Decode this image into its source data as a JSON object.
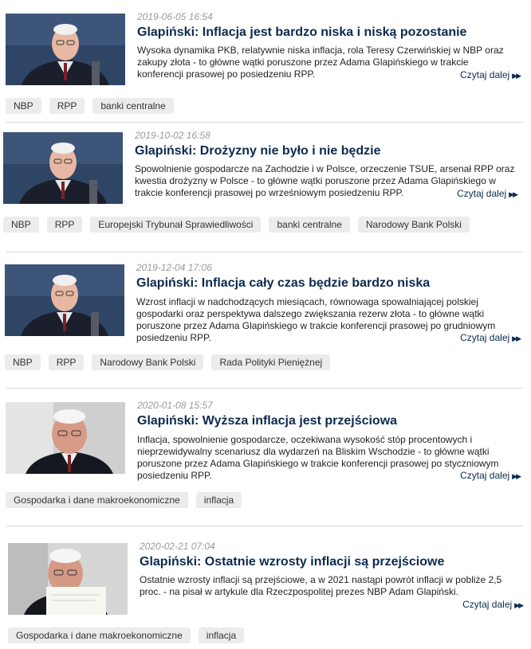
{
  "articles": [
    {
      "date": "2019-06-05 16:54",
      "title": "Glapiński: Inflacja jest bardzo niska i niską pozostanie",
      "desc": "Wysoka dynamika PKB, relatywnie niska inflacja, rola Teresy Czerwińskiej w NBP oraz zakupy złota - to główne wątki poruszone przez Adama Glapińskiego w trakcie konferencji prasowej po posiedzeniu RPP.",
      "more": "Czytaj dalej",
      "tags": [
        "NBP",
        "RPP",
        "banki centralne"
      ]
    },
    {
      "date": "2019-10-02 16:58",
      "title": "Glapiński: Drożyzny nie było i nie będzie",
      "desc": "Spowolnienie gospodarcze na Zachodzie i w Polsce, orzeczenie TSUE, arsenał RPP oraz kwestia drożyzny w Polsce - to główne wątki poruszone przez Adama Glapińskiego w trakcie konferencji prasowej po wrześniowym posiedzeniu RPP.",
      "more": "Czytaj dalej",
      "tags": [
        "NBP",
        "RPP",
        "Europejski Trybunał Sprawiedliwości",
        "banki centralne",
        "Narodowy Bank Polski"
      ]
    },
    {
      "date": "2019-12-04 17:06",
      "title": "Glapiński: Inflacja cały czas będzie bardzo niska",
      "desc": "Wzrost inflacji w nadchodzących miesiącach, równowaga spowalniającej polskiej gospodarki oraz perspektywa dalszego zwiększania rezerw złota - to główne wątki poruszone przez Adama Glapińskiego w trakcie konferencji prasowej po grudniowym posiedzeniu RPP.",
      "more": "Czytaj dalej",
      "tags": [
        "NBP",
        "RPP",
        "Narodowy Bank Polski",
        "Rada Polityki Pieniężnej"
      ]
    },
    {
      "date": "2020-01-08 15:57",
      "title": "Glapiński: Wyższa inflacja jest przejściowa",
      "desc": "Inflacja, spowolnienie gospodarcze, oczekiwana wysokość stóp procentowych i nieprzewidywalny scenariusz dla wydarzeń na Bliskim Wschodzie - to główne wątki poruszone przez Adama Glapińskiego w trakcie konferencji prasowej po styczniowym posiedzeniu RPP.",
      "more": "Czytaj dalej",
      "tags": [
        "Gospodarka i dane makroekonomiczne",
        "inflacja"
      ]
    },
    {
      "date": "2020-02-21 07:04",
      "title": "Glapiński: Ostatnie wzrosty inflacji są przejściowe",
      "desc": "Ostatnie wzrosty inflacji są przejściowe, a w 2021 nastąpi powrót inflacji w pobliże 2,5 proc. - na pisał w artykule dla Rzeczpospolitej prezes NBP Adam Glapiński.",
      "more": "Czytaj dalej",
      "tags": [
        "Gospodarka i dane makroekonomiczne",
        "inflacja"
      ]
    }
  ]
}
